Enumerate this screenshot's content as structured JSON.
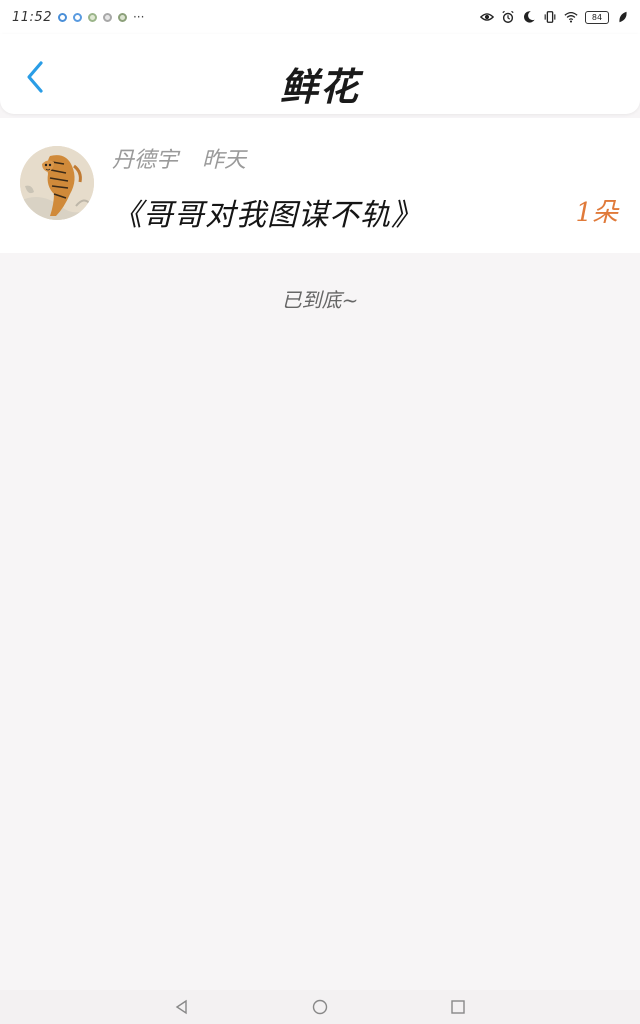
{
  "status_bar": {
    "time": "11:52",
    "more": "···",
    "battery": "84"
  },
  "header": {
    "title": "鲜花"
  },
  "list": [
    {
      "author": "丹德宇",
      "time": "昨天",
      "book_title": "《哥哥对我图谋不轨》",
      "flower_count": "1朵"
    }
  ],
  "footer_text": "已到底~",
  "colors": {
    "accent_blue": "#2a9de6",
    "count_orange": "#e07a3a"
  }
}
